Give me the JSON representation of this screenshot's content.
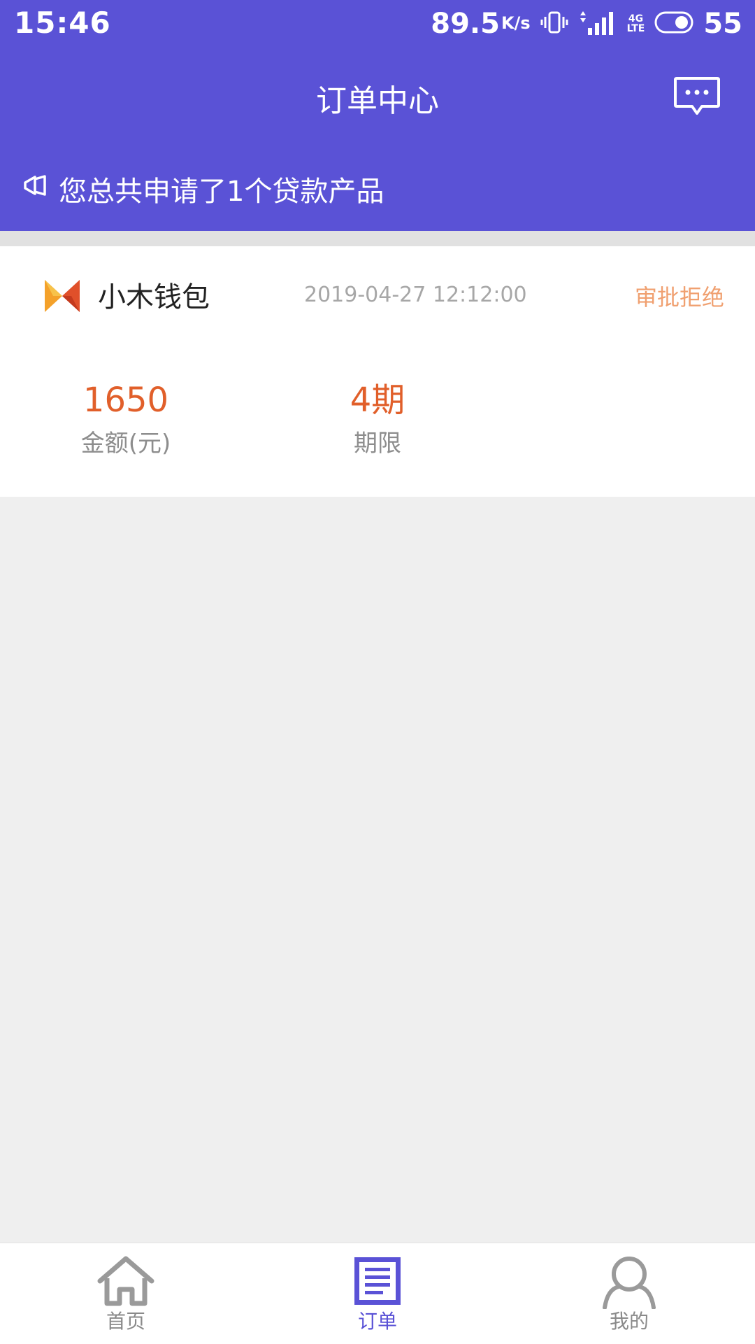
{
  "status_bar": {
    "time": "15:46",
    "network_speed": "89.5",
    "speed_unit": "K/s",
    "network_type": "4G",
    "network_type_sub": "LTE",
    "battery": "55"
  },
  "header": {
    "title": "订单中心"
  },
  "notice": {
    "text": "您总共申请了1个贷款产品"
  },
  "orders": [
    {
      "product_name": "小木钱包",
      "date": "2019-04-27 12:12:00",
      "status": "审批拒绝",
      "amount_value": "1650",
      "amount_label": "金额(元)",
      "term_value": "4期",
      "term_label": "期限"
    }
  ],
  "tabs": [
    {
      "label": "首页",
      "icon": "home-icon",
      "active": false
    },
    {
      "label": "订单",
      "icon": "order-list-icon",
      "active": true
    },
    {
      "label": "我的",
      "icon": "person-icon",
      "active": false
    }
  ],
  "colors": {
    "primary": "#5a52d6",
    "accent_value": "#e15f2a",
    "status_rejected": "#f0a070",
    "background": "#efefef"
  }
}
